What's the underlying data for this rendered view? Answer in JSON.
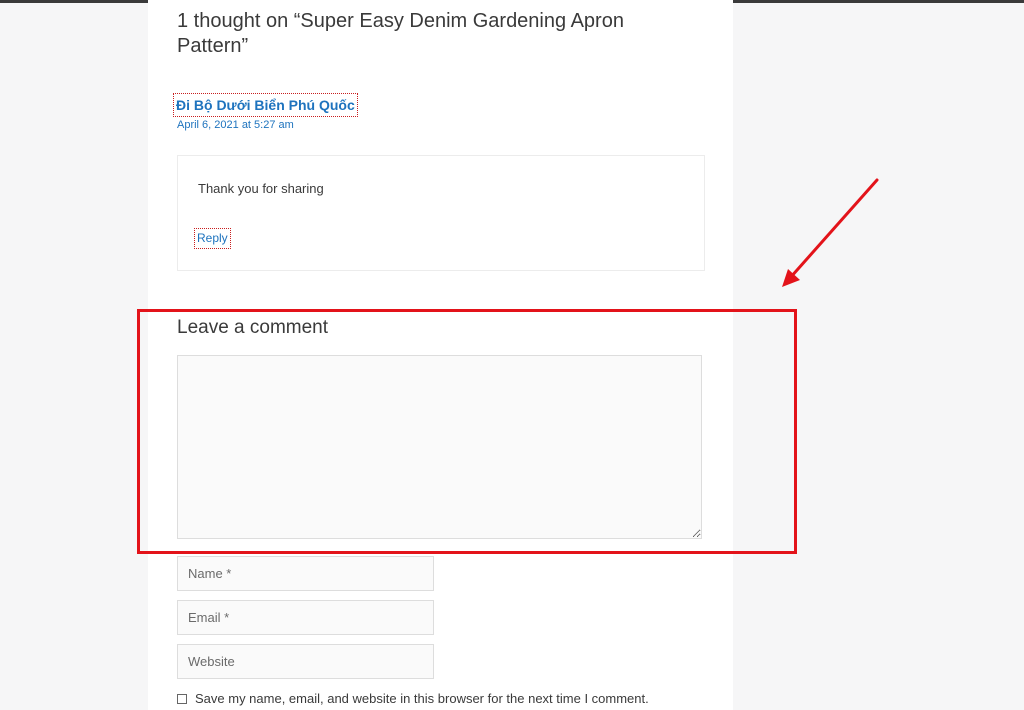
{
  "comments": {
    "title": "1 thought on “Super Easy Denim Gardening Apron Pattern”",
    "items": [
      {
        "author": "Đi Bộ Dưới Biển Phú Quốc",
        "date": "April 6, 2021 at 5:27 am",
        "text": "Thank you for sharing",
        "reply_label": "Reply"
      }
    ]
  },
  "comment_form": {
    "title": "Leave a comment",
    "comment_value": "",
    "name_placeholder": "Name *",
    "email_placeholder": "Email *",
    "website_placeholder": "Website",
    "save_info_label": "Save my name, email, and website in this browser for the next time I comment."
  },
  "annotation": {
    "highlight_color": "#e3131a"
  }
}
